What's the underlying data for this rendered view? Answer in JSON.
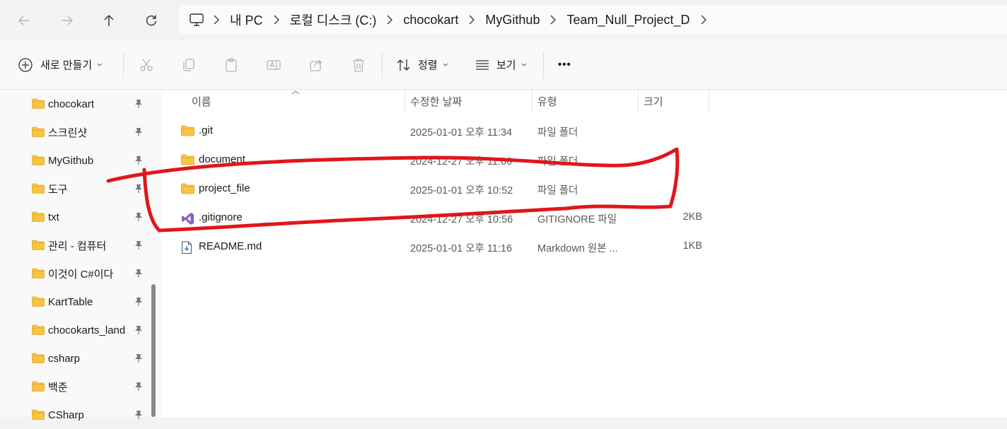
{
  "nav": {
    "back_icon": "arrow-left-icon",
    "forward_icon": "arrow-right-icon",
    "up_icon": "arrow-up-icon",
    "refresh_icon": "refresh-icon"
  },
  "breadcrumb": {
    "root_icon": "computer-icon",
    "items": [
      "내 PC",
      "로컬 디스크 (C:)",
      "chocokart",
      "MyGithub",
      "Team_Null_Project_D"
    ]
  },
  "toolbar": {
    "new_label": "새로 만들기",
    "sort_label": "정렬",
    "view_label": "보기",
    "more_label": "•••"
  },
  "sidebar": {
    "items": [
      {
        "label": "chocokart"
      },
      {
        "label": "스크린샷"
      },
      {
        "label": "MyGithub"
      },
      {
        "label": "도구"
      },
      {
        "label": "txt"
      },
      {
        "label": "관리 - 컴퓨터"
      },
      {
        "label": "이것이 C#이다"
      },
      {
        "label": "KartTable"
      },
      {
        "label": "chocokarts_land"
      },
      {
        "label": "csharp"
      },
      {
        "label": "백준"
      },
      {
        "label": "CSharp"
      }
    ]
  },
  "columns": {
    "name": "이름",
    "modified": "수정한 날짜",
    "type": "유형",
    "size": "크기"
  },
  "files": [
    {
      "name": ".git",
      "date": "2025-01-01 오후 11:34",
      "type": "파일 폴더",
      "size": "",
      "icon": "folder-icon"
    },
    {
      "name": "document",
      "date": "2024-12-27 오후 11:06",
      "type": "파일 폴더",
      "size": "",
      "icon": "folder-icon"
    },
    {
      "name": "project_file",
      "date": "2025-01-01 오후 10:52",
      "type": "파일 폴더",
      "size": "",
      "icon": "folder-icon"
    },
    {
      "name": ".gitignore",
      "date": "2024-12-27 오후 10:56",
      "type": "GITIGNORE 파일",
      "size": "2KB",
      "icon": "visual-studio-icon"
    },
    {
      "name": "README.md",
      "date": "2025-01-01 오후 11:16",
      "type": "Markdown 원본 ...",
      "size": "1KB",
      "icon": "markdown-file-icon"
    }
  ],
  "colors": {
    "folder": "#f8c443",
    "annotation": "#e0161b",
    "vs_purple": "#8661c5"
  }
}
